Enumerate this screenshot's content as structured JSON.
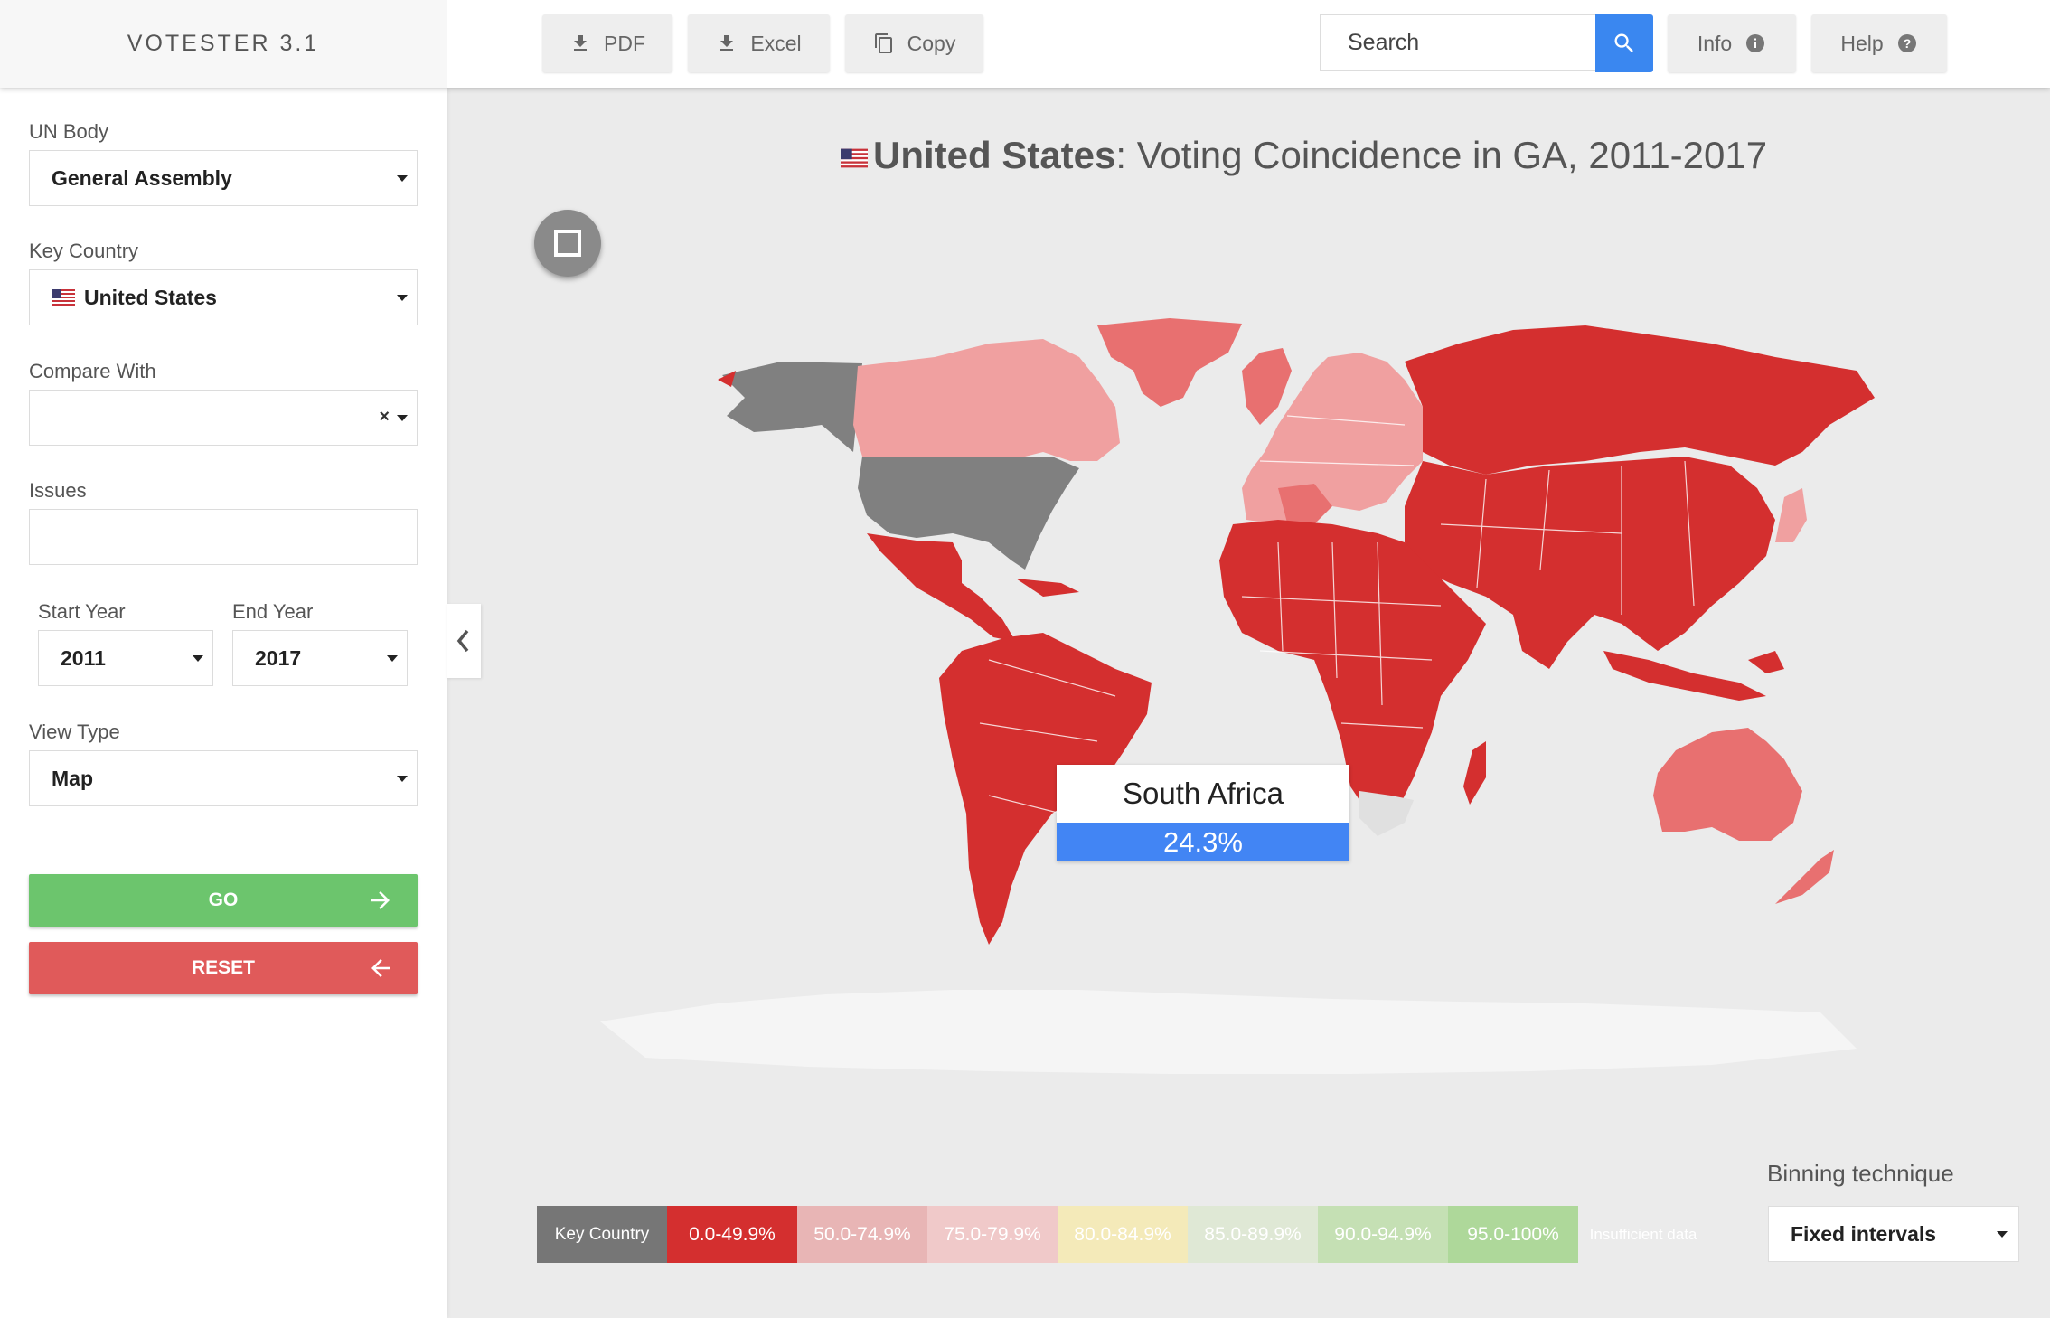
{
  "app": {
    "title": "VOTESTER 3.1"
  },
  "toolbar": {
    "pdf_label": "PDF",
    "excel_label": "Excel",
    "copy_label": "Copy",
    "search_placeholder": "Search",
    "info_label": "Info",
    "help_label": "Help"
  },
  "sidebar": {
    "un_body": {
      "label": "UN Body",
      "value": "General Assembly"
    },
    "key_country": {
      "label": "Key Country",
      "value": "United States"
    },
    "compare_with": {
      "label": "Compare With",
      "value": "",
      "clear": "×"
    },
    "issues": {
      "label": "Issues",
      "value": ""
    },
    "start_year": {
      "label": "Start Year",
      "value": "2011"
    },
    "end_year": {
      "label": "End Year",
      "value": "2017"
    },
    "view_type": {
      "label": "View Type",
      "value": "Map"
    },
    "go_label": "GO",
    "reset_label": "RESET"
  },
  "main": {
    "title_country": "United States",
    "title_rest": ": Voting Coincidence in GA, 2011-2017",
    "tooltip": {
      "country": "South Africa",
      "value": "24.3%"
    },
    "legend": [
      {
        "label": "Key Country",
        "color": "#767676"
      },
      {
        "label": "0.0-49.9%",
        "color": "#d42f2f"
      },
      {
        "label": "50.0-74.9%",
        "color": "#e8b5b5"
      },
      {
        "label": "75.0-79.9%",
        "color": "#f0c9c9"
      },
      {
        "label": "80.0-84.9%",
        "color": "#f4eab9"
      },
      {
        "label": "85.0-89.9%",
        "color": "#dfe8d5"
      },
      {
        "label": "90.0-94.9%",
        "color": "#c5e0b4"
      },
      {
        "label": "95.0-100%",
        "color": "#aed89a"
      },
      {
        "label": "Insufficient data",
        "color": "#ebebeb"
      }
    ],
    "binning": {
      "label": "Binning technique",
      "value": "Fixed intervals"
    }
  },
  "colors": {
    "accent": "#3a87f0",
    "go": "#6cc56d",
    "reset": "#e05a5a",
    "map_low": "#d42f2f",
    "map_mid": "#e87070",
    "map_light": "#f0a0a0",
    "key_country": "#808080",
    "no_data": "#f5f5f5"
  }
}
